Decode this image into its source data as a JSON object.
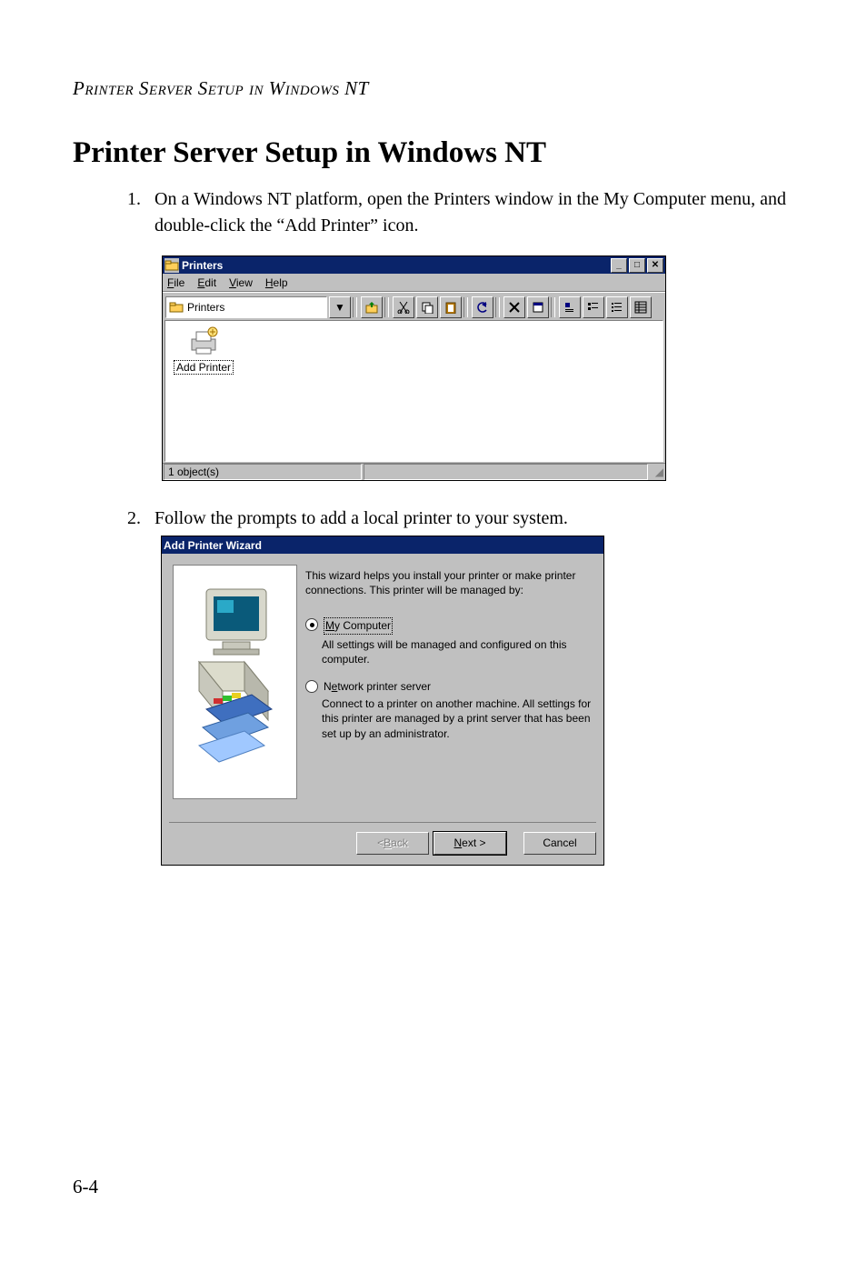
{
  "page": {
    "running_head": "Printer Server Setup in Windows NT",
    "title": "Printer Server Setup in Windows NT",
    "number": "6-4"
  },
  "steps": [
    "On a Windows NT platform, open the Printers window in the My Computer menu, and double-click the “Add Printer” icon.",
    "Follow the prompts to add a local printer to your system."
  ],
  "printers_window": {
    "title": "Printers",
    "menus": {
      "file": "File",
      "edit": "Edit",
      "view": "View",
      "help": "Help"
    },
    "address_label": "Printers",
    "icon_label": "Add Printer",
    "status": "1 object(s)"
  },
  "wizard": {
    "title": "Add Printer Wizard",
    "intro": "This wizard helps you install your printer or make printer connections.  This printer will be managed by:",
    "opt1": {
      "label": "My Computer",
      "desc": "All settings will be managed and configured on this computer."
    },
    "opt2": {
      "label": "Network printer server",
      "desc": "Connect to a printer on another machine.  All settings for this printer are managed by a print server that has been set up by an administrator."
    },
    "buttons": {
      "back": "< Back",
      "next": "Next >",
      "cancel": "Cancel"
    }
  }
}
